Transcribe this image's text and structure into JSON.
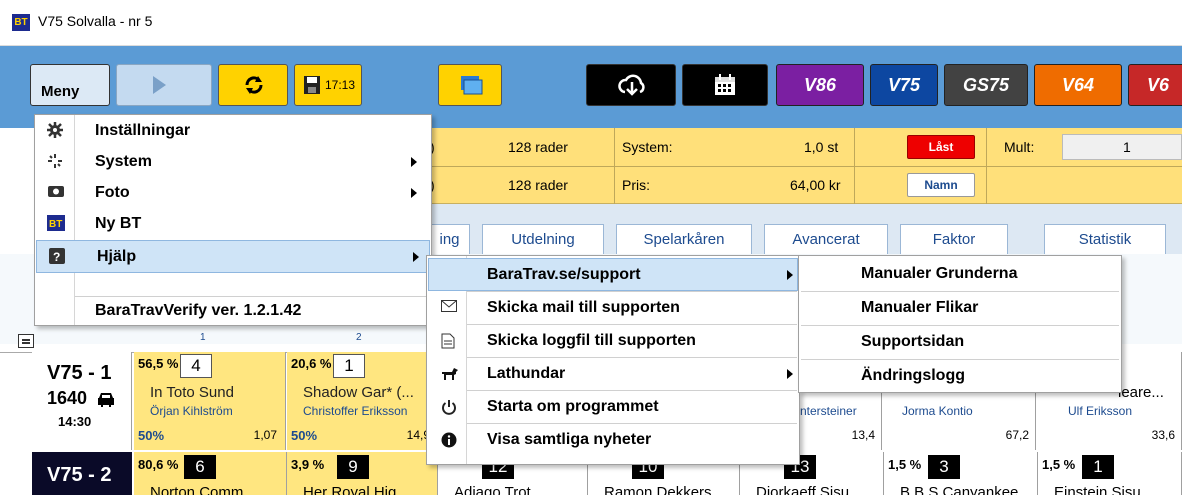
{
  "window": {
    "title": "V75 Solvalla - nr 5",
    "logo": "BT"
  },
  "toolbar": {
    "menu_label": "Meny",
    "save_time": "17:13",
    "games": [
      {
        "label": "V86",
        "color": "#7b1fa2"
      },
      {
        "label": "V75",
        "color": "#0d47a1"
      },
      {
        "label": "GS75",
        "color": "#424242"
      },
      {
        "label": "V64",
        "color": "#ef6c00"
      },
      {
        "label": "V6",
        "color": "#c62828"
      }
    ]
  },
  "infobar": {
    "row1": {
      "rows": "128 rader",
      "label": "System:",
      "value": "1,0 st",
      "lock": "Låst",
      "mult_label": "Mult:",
      "mult_value": "1"
    },
    "row2": {
      "rows": "128 rader",
      "label": "Pris:",
      "value": "64,00 kr",
      "name_btn": "Namn"
    },
    "left_frag1": ")",
    "left_frag2": ")"
  },
  "tabs": [
    "ing",
    "Utdelning",
    "Spelarkåren",
    "Avancerat",
    "Faktor",
    "Statistik"
  ],
  "grid": {
    "races": [
      {
        "id": "V75 - 1",
        "dist": "1640",
        "time": "14:30"
      },
      {
        "id": "V75 - 2"
      }
    ],
    "race1": [
      {
        "pct": "56,5 %",
        "num": "4",
        "name": "In Toto Sund",
        "driver": "Örjan Kihlström",
        "p1": "50%",
        "odds": "1,07"
      },
      {
        "pct": "20,6 %",
        "num": "1",
        "name": "Shadow Gar* (...",
        "driver": "Christoffer Eriksson",
        "p1": "50%",
        "odds": "14,9"
      }
    ],
    "race1_right": [
      {
        "driver": "ntersteiner",
        "odds": "13,4"
      },
      {
        "driver": "Jorma Kontio",
        "odds": "67,2"
      },
      {
        "name": "leare...",
        "driver": "Ulf Eriksson",
        "odds": "33,6"
      }
    ],
    "race2": [
      {
        "pct": "80,6 %",
        "num": "6",
        "name": "Norton Comm"
      },
      {
        "pct": "3,9 %",
        "num": "9",
        "name": "Her Royal Hig"
      },
      {
        "pct": "",
        "num": "12",
        "name": "Adiago Trot"
      },
      {
        "pct": "",
        "num": "10",
        "name": "Ramon Dekkers"
      },
      {
        "pct": "",
        "num": "13",
        "name": "Djorkaeff Sisu"
      },
      {
        "pct": "1,5 %",
        "num": "3",
        "name": "B.B.S Canyankee"
      },
      {
        "pct": "1,5 %",
        "num": "1",
        "name": "Einstein Sisu"
      }
    ],
    "header_nums": [
      "1",
      "2"
    ]
  },
  "menu": {
    "items": [
      {
        "label": "Inställningar",
        "icon": "gear-icon"
      },
      {
        "label": "System",
        "icon": "sparkle-icon",
        "submenu": true
      },
      {
        "label": "Foto",
        "icon": "camera-icon",
        "submenu": true
      },
      {
        "label": "Ny BT",
        "icon": "bt-logo-icon"
      },
      {
        "label": "Hjälp",
        "icon": "help-icon",
        "submenu": true
      }
    ],
    "version_label": "BaraTravVerify   ver. 1.2.1.42"
  },
  "help_menu": {
    "items": [
      {
        "label": "BaraTrav.se/support",
        "icon": "",
        "submenu": true
      },
      {
        "label": "Skicka mail till supporten",
        "icon": "envelope-icon"
      },
      {
        "label": "Skicka loggfil till supporten",
        "icon": "document-icon"
      },
      {
        "label": "Lathundar",
        "icon": "horse-icon",
        "submenu": true
      },
      {
        "label": "Starta om programmet",
        "icon": "power-icon"
      },
      {
        "label": "Visa samtliga nyheter",
        "icon": "info-icon"
      }
    ]
  },
  "support_menu": {
    "items": [
      "Manualer Grunderna",
      "Manualer Flikar",
      "Supportsidan",
      "Ändringslogg"
    ]
  }
}
